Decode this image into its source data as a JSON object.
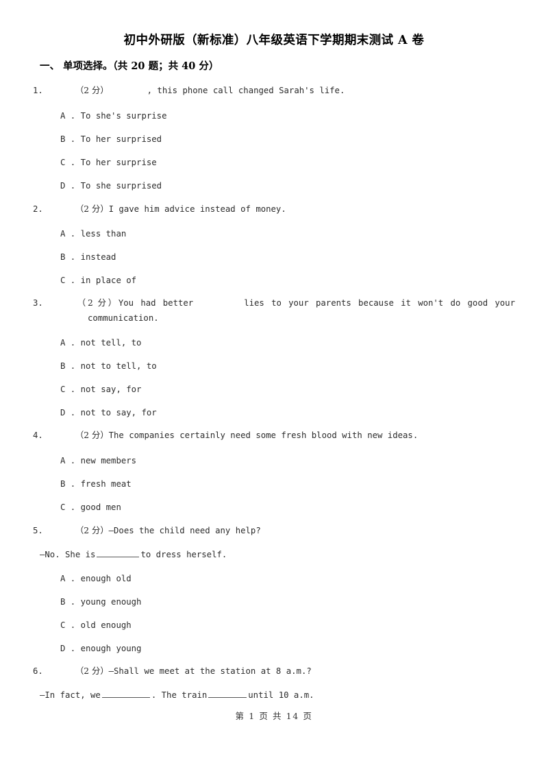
{
  "document": {
    "title": "初中外研版（新标准）八年级英语下学期期末测试 A 卷",
    "section_header": "一、 单项选择。（共 20 题；共 40 分）",
    "footer": "第 1 页 共 14 页"
  },
  "questions": [
    {
      "number": "1.",
      "score": "（2 分）",
      "stem_part1": "",
      "stem_part2": ", this phone call changed Sarah's life.",
      "options": [
        {
          "letter": "A .",
          "text": "To she's surprise"
        },
        {
          "letter": "B .",
          "text": "To her surprised"
        },
        {
          "letter": "C .",
          "text": "To her surprise"
        },
        {
          "letter": "D .",
          "text": "To she surprised"
        }
      ]
    },
    {
      "number": "2.",
      "score": "（2 分）",
      "stem_part1": "I gave him advice instead of money.",
      "stem_part2": "",
      "options": [
        {
          "letter": "A .",
          "text": "less than"
        },
        {
          "letter": "B .",
          "text": "instead"
        },
        {
          "letter": "C .",
          "text": "in place of"
        }
      ]
    },
    {
      "number": "3.",
      "score": "（2 分）",
      "stem_part1": "You had better",
      "stem_part2": "lies to your parents because it won't do good your communication.",
      "options": [
        {
          "letter": "A .",
          "text": "not tell, to"
        },
        {
          "letter": "B .",
          "text": "not to tell, to"
        },
        {
          "letter": "C .",
          "text": "not say, for"
        },
        {
          "letter": "D .",
          "text": "not to say, for"
        }
      ]
    },
    {
      "number": "4.",
      "score": "（2 分）",
      "stem_part1": "The companies certainly need some fresh blood with new ideas.",
      "stem_part2": "",
      "options": [
        {
          "letter": "A .",
          "text": "new members"
        },
        {
          "letter": "B .",
          "text": "fresh meat"
        },
        {
          "letter": "C .",
          "text": "good men"
        }
      ]
    },
    {
      "number": "5.",
      "score": "（2 分）",
      "stem_part1": "—Does the child need any help?",
      "answer_part1": "—No. She is",
      "answer_part2": "to dress herself.",
      "options": [
        {
          "letter": "A .",
          "text": "enough old"
        },
        {
          "letter": "B .",
          "text": "young enough"
        },
        {
          "letter": "C .",
          "text": "old enough"
        },
        {
          "letter": "D .",
          "text": "enough young"
        }
      ]
    },
    {
      "number": "6.",
      "score": "（2 分）",
      "stem_part1": "—Shall we meet at the station at 8 a.m.?",
      "answer_part1": "—In fact, we",
      "answer_part2": ". The train",
      "answer_part3": "until 10 a.m.",
      "options": []
    }
  ]
}
